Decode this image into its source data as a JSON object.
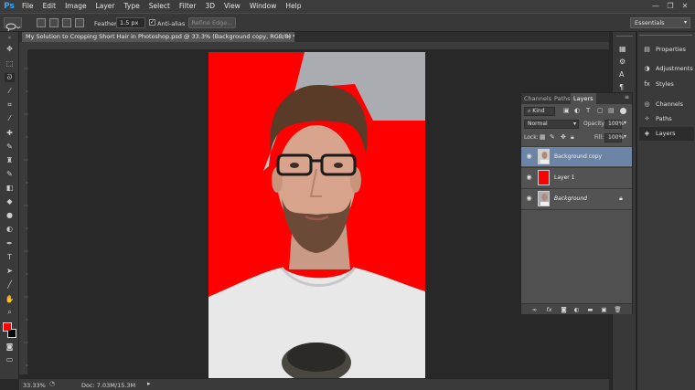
{
  "app": {
    "logo": "Ps",
    "menus": [
      "File",
      "Edit",
      "Image",
      "Layer",
      "Type",
      "Select",
      "Filter",
      "3D",
      "View",
      "Window",
      "Help"
    ]
  },
  "window_controls": {
    "minimize": "—",
    "restore": "❐",
    "close": "✕"
  },
  "options": {
    "feather_label": "Feather:",
    "feather_value": "1.5 px",
    "antialias_label": "Anti-alias",
    "refine_edge": "Refine Edge...",
    "workspace": "Essentials"
  },
  "document": {
    "tab_title": "My Solution to Cropping Short Hair in Photoshop.psd @ 33.3% (Background copy, RGB/8) *",
    "close": "×"
  },
  "status": {
    "zoom": "33.33%",
    "doc": "Doc: 7.03M/15.3M"
  },
  "panel_list": {
    "properties": "Properties",
    "adjustments": "Adjustments",
    "styles": "Styles",
    "channels": "Channels",
    "paths": "Paths",
    "layers": "Layers"
  },
  "layers_panel": {
    "tabs": [
      "Channels",
      "Paths",
      "Layers"
    ],
    "kind": "Kind",
    "blend_mode": "Normal",
    "opacity_label": "Opacity:",
    "opacity_value": "100%",
    "lock_label": "Lock:",
    "fill_label": "Fill:",
    "fill_value": "100%",
    "layers": [
      {
        "name": "Background copy",
        "selected": true
      },
      {
        "name": "Layer 1",
        "selected": false
      },
      {
        "name": "Background",
        "selected": false,
        "locked": true
      }
    ]
  },
  "colors": {
    "foreground": "#ff0000",
    "background": "#000000",
    "selection": "#6c84a6",
    "canvas_fill": "#ff0000"
  }
}
